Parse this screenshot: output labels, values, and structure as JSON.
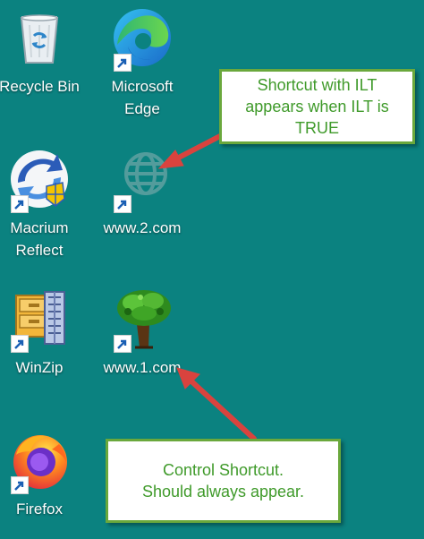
{
  "desktop": {
    "background_color": "#0b8280",
    "icons": [
      {
        "label": "Recycle Bin",
        "icon": "recycle-bin-icon"
      },
      {
        "label": "Microsoft\nEdge",
        "icon": "edge-icon"
      },
      {
        "label": "Macrium\nReflect",
        "icon": "macrium-reflect-icon"
      },
      {
        "label": "www.2.com",
        "icon": "globe-icon"
      },
      {
        "label": "WinZip",
        "icon": "winzip-icon"
      },
      {
        "label": "www.1.com",
        "icon": "tree-icon"
      },
      {
        "label": "Firefox",
        "icon": "firefox-icon"
      }
    ]
  },
  "annotations": {
    "callout_top": "Shortcut with ILT\nappears when ILT is\nTRUE",
    "callout_bottom": "Control Shortcut.\nShould always appear.",
    "border_color": "#6aa83c",
    "text_color": "#3f9a2a",
    "arrow_color": "#d9433e"
  }
}
